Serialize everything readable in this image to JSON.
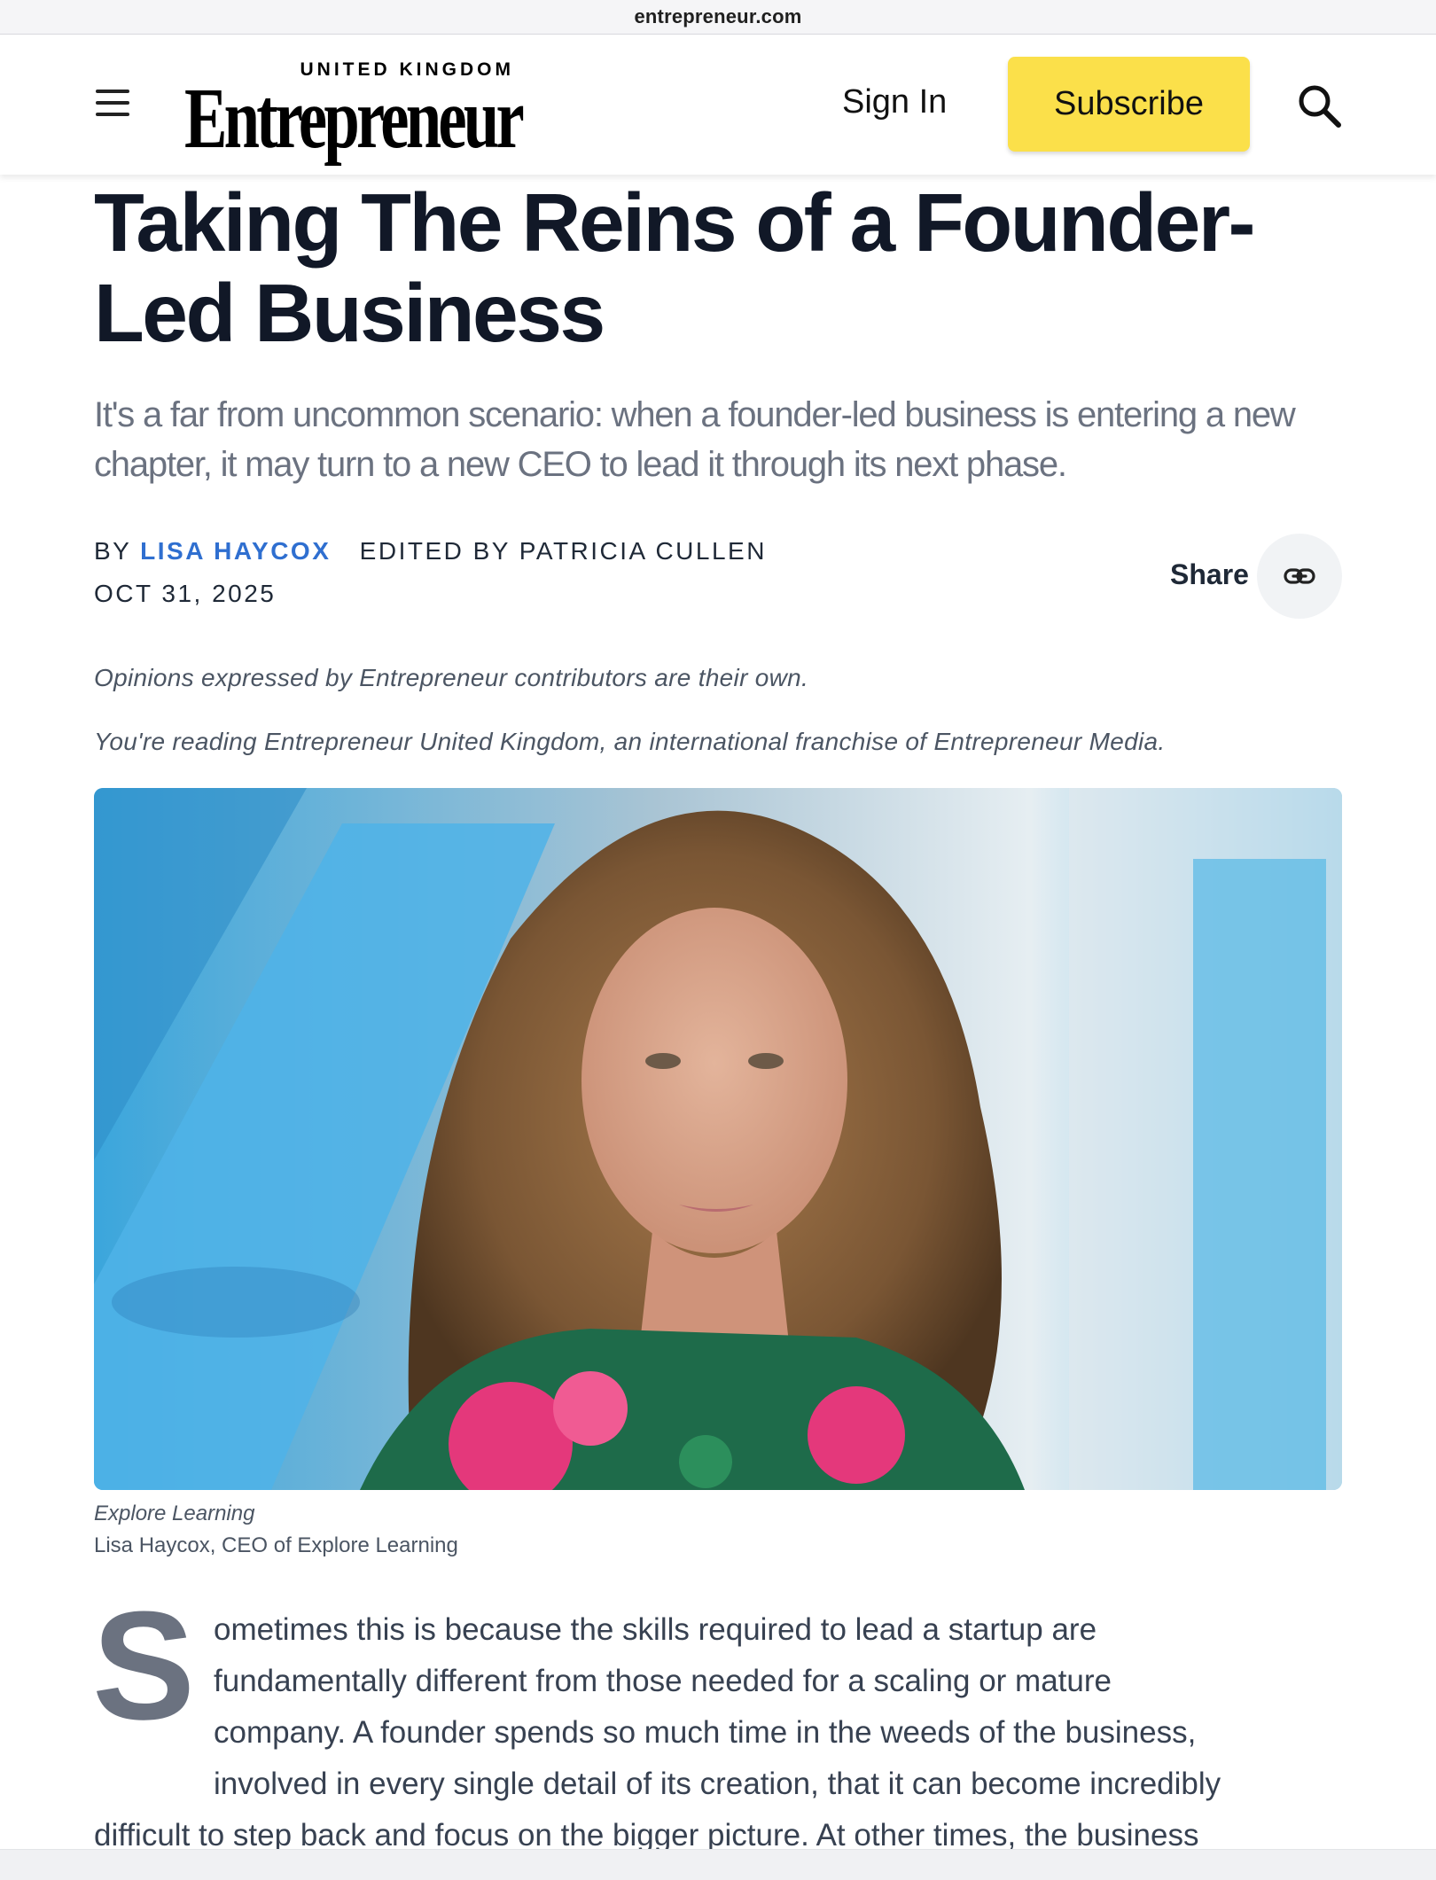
{
  "browser": {
    "url": "entrepreneur.com"
  },
  "header": {
    "logo_edition": "UNITED KINGDOM",
    "logo_word": "Entrepreneur",
    "sign_in_label": "Sign In",
    "subscribe_label": "Subscribe",
    "subscribe_color": "#fbe04a",
    "icons": [
      "menu-icon",
      "search-icon"
    ]
  },
  "article": {
    "title": "Taking The Reins of a Founder-Led Business",
    "dek": "It's a far from uncommon scenario: when a founder-led business is entering a new chapter, it may turn to a new CEO to lead it through its next phase.",
    "byline_prefix": "BY",
    "author": "LISA HAYCOX",
    "author_color": "#2f6fd0",
    "edited_by": "EDITED BY PATRICIA CULLEN",
    "date": "OCT 31, 2025",
    "share_label": "Share",
    "share_icon": "link-icon",
    "disclaimer_1": "Opinions expressed by Entrepreneur contributors are their own.",
    "disclaimer_2": "You're reading Entrepreneur United Kingdom, an international franchise of Entrepreneur Media.",
    "image": {
      "description_icon": "portrait-photo",
      "credit": "Explore Learning",
      "caption": "Lisa Haycox, CEO of Explore Learning"
    },
    "drop_cap": "S",
    "body_first_line_rest": "ometimes this is because the skills required to lead a startup are",
    "body_lines": [
      "fundamentally different from those needed for a scaling or mature",
      "company. A founder spends so much time in the weeds of the business,",
      "involved in every single detail of its creation, that it can become incredibly"
    ],
    "body_continuation": "difficult to step back and focus on the bigger picture. At other times, the business"
  }
}
